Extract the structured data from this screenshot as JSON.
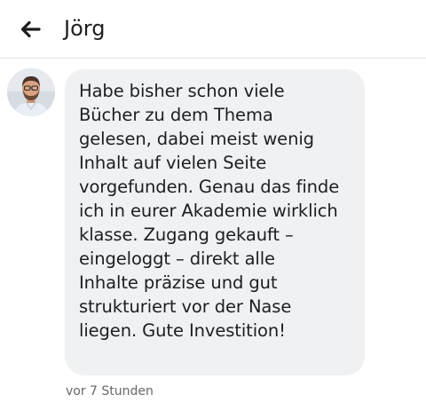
{
  "header": {
    "back_icon": "arrow-left-icon",
    "title": "Jörg"
  },
  "message": {
    "avatar": "user-avatar",
    "text": "Habe bisher schon viele\nBücher zu dem Thema\ngelesen, dabei meist wenig\nInhalt auf vielen Seite\nvorgefunden. Genau das finde\nich in eurer Akademie wirklich\nklasse. Zugang gekauft –\neingeloggt – direkt alle\nInhalte präzise und gut\nstrukturiert vor der Nase\nliegen. Gute Investition!",
    "timestamp": "vor 7 Stunden"
  },
  "colors": {
    "bubble_background": "#f0f1f2",
    "text": "#1c1e21",
    "timestamp": "#65676b"
  }
}
